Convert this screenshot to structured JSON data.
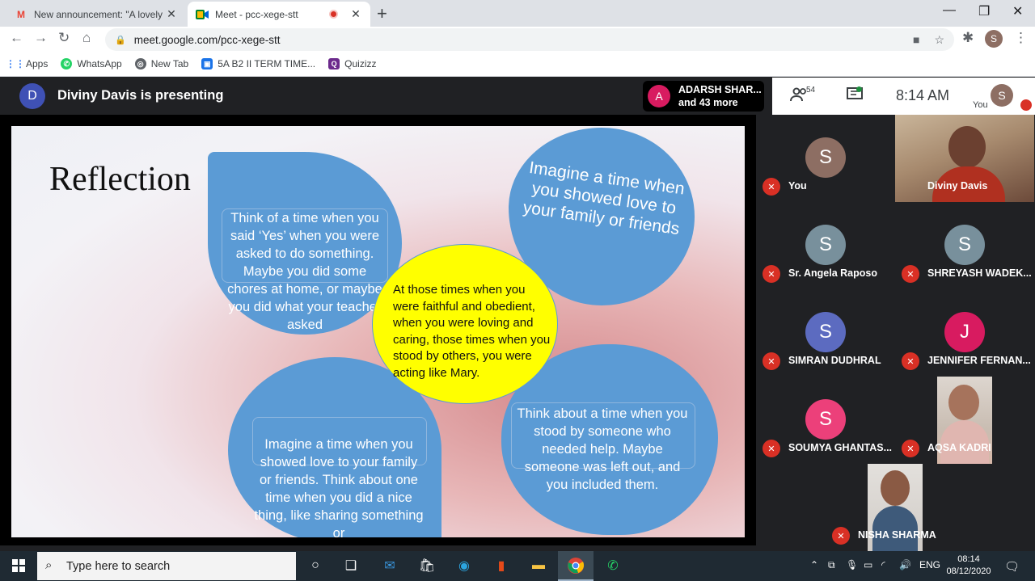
{
  "browser": {
    "tabs": [
      {
        "title": "New announcement: \"A lovely m",
        "favicon": "gmail-icon"
      },
      {
        "title": "Meet - pcc-xege-stt",
        "favicon": "meet-icon",
        "active": true
      }
    ],
    "url": "meet.google.com/pcc-xege-stt",
    "profile_initial": "S",
    "bookmarks": [
      {
        "label": "Apps",
        "icon": "apps-grid-icon",
        "color": "#4285f4"
      },
      {
        "label": "WhatsApp",
        "icon": "whatsapp-icon",
        "color": "#25d366"
      },
      {
        "label": "New Tab",
        "icon": "globe-icon",
        "color": "#5f6368"
      },
      {
        "label": "5A B2 II TERM TIME...",
        "icon": "contacts-icon",
        "color": "#1a73e8"
      },
      {
        "label": "Quizizz",
        "icon": "quizizz-icon",
        "color": "#6c2a8c"
      }
    ]
  },
  "meet": {
    "presenter_initial": "D",
    "presenting_text": "Diviny Davis is presenting",
    "others": {
      "initial": "A",
      "line1": "ADARSH SHAR...",
      "line2": "and 43 more"
    },
    "participant_count": "54",
    "time": "8:14 AM",
    "self_label": "You",
    "self_initial": "S"
  },
  "slide": {
    "title": "Reflection",
    "top_left": "Think of a time when you said ‘Yes’ when you were asked to do something. Maybe you did some chores at home, or maybe you did what your teacher asked",
    "top_right": "Imagine a time when you showed love to your family or friends",
    "center": "At those times when you were faithful and obedient, when you were loving and caring, those times when you stood by others, you were acting like Mary.",
    "bottom_left": "Imagine a time when you showed love to your family or friends. Think about one time when you did a nice thing, like sharing something or",
    "bottom_right": "Think about a time when you stood by someone who needed help. Maybe someone was left out, and you included them."
  },
  "participants": [
    {
      "name": "You",
      "initial": "S",
      "color": "#8d6e63"
    },
    {
      "name": "Diviny Davis",
      "video": true
    },
    {
      "name": "Sr. Angela Raposo",
      "initial": "S",
      "color": "#78909c"
    },
    {
      "name": "SHREYASH WADEK...",
      "initial": "S",
      "color": "#78909c"
    },
    {
      "name": "SIMRAN DUDHRAL",
      "initial": "S",
      "color": "#5c6bc0"
    },
    {
      "name": "JENNIFER FERNAN...",
      "initial": "J",
      "color": "#d81b60"
    },
    {
      "name": "SOUMYA GHANTAS...",
      "initial": "S",
      "color": "#ec407a"
    },
    {
      "name": "AQSA KADRI",
      "video": true
    },
    {
      "name": "NISHA SHARMA",
      "video": true
    }
  ],
  "taskbar": {
    "search_placeholder": "Type here to search",
    "language": "ENG",
    "clock_time": "08:14",
    "clock_date": "08/12/2020"
  }
}
